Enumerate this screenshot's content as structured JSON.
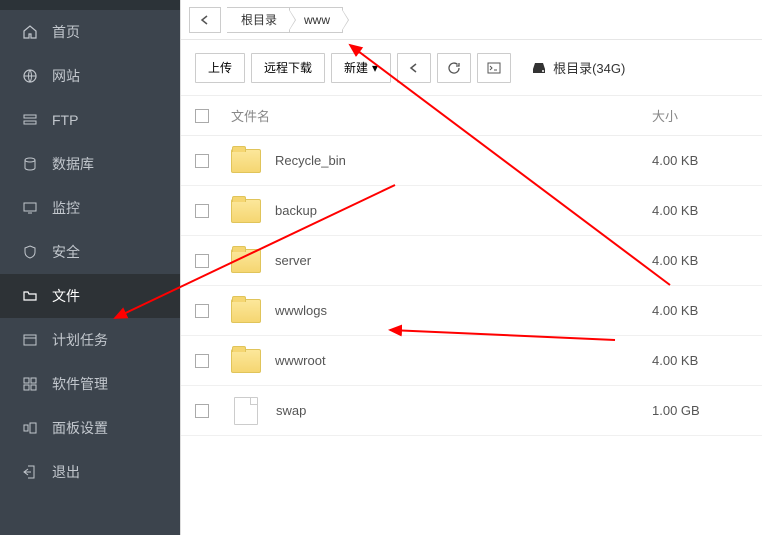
{
  "sidebar": {
    "items": [
      {
        "label": "首页"
      },
      {
        "label": "网站"
      },
      {
        "label": "FTP"
      },
      {
        "label": "数据库"
      },
      {
        "label": "监控"
      },
      {
        "label": "安全"
      },
      {
        "label": "文件"
      },
      {
        "label": "计划任务"
      },
      {
        "label": "软件管理"
      },
      {
        "label": "面板设置"
      },
      {
        "label": "退出"
      }
    ]
  },
  "breadcrumb": {
    "root": "根目录",
    "path": "www"
  },
  "toolbar": {
    "upload": "上传",
    "remote": "远程下载",
    "create": "新建",
    "disk_label": "根目录(34G)"
  },
  "table": {
    "head_name": "文件名",
    "head_size": "大小",
    "rows": [
      {
        "name": "Recycle_bin",
        "size": "4.00 KB",
        "type": "folder"
      },
      {
        "name": "backup",
        "size": "4.00 KB",
        "type": "folder"
      },
      {
        "name": "server",
        "size": "4.00 KB",
        "type": "folder"
      },
      {
        "name": "wwwlogs",
        "size": "4.00 KB",
        "type": "folder"
      },
      {
        "name": "wwwroot",
        "size": "4.00 KB",
        "type": "folder"
      },
      {
        "name": "swap",
        "size": "1.00 GB",
        "type": "file"
      }
    ]
  }
}
